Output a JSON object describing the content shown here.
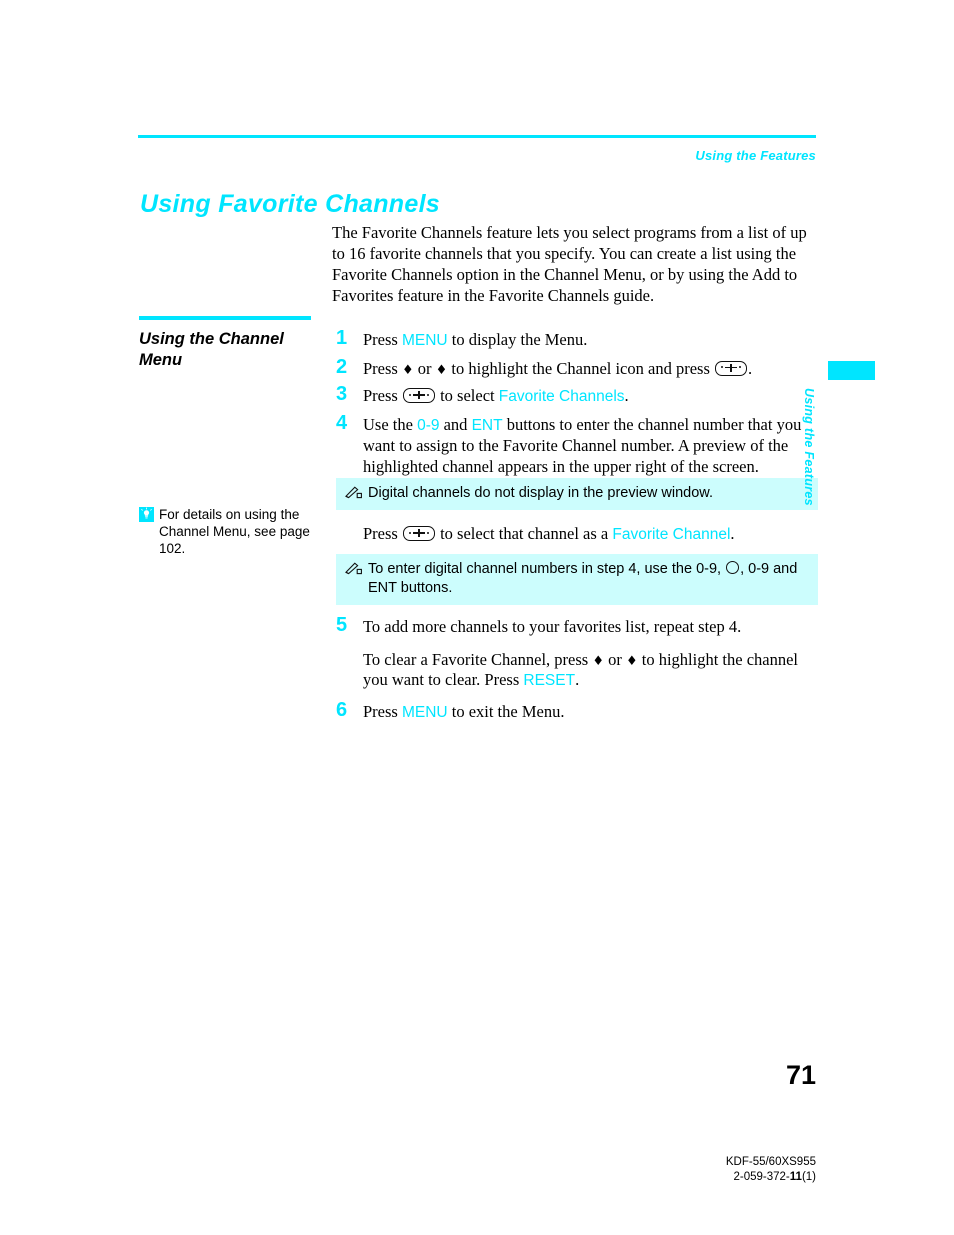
{
  "header": {
    "running_head": "Using the Features",
    "rule_color": "#00e5ff"
  },
  "title": "Using Favorite Channels",
  "intro": "The Favorite Channels feature lets you select programs from a list of up to 16 favorite channels that you specify. You can create a list using the Favorite Channels option in the Channel Menu, or by using the Add to Favorites feature in the Favorite Channels guide.",
  "section": {
    "heading": "Using the Channel Menu"
  },
  "tip": {
    "icon": "lightbulb-icon",
    "text": "For details on using the Channel Menu, see page 102."
  },
  "steps": [
    {
      "num": "1",
      "pre": "Press ",
      "kw1": "MENU",
      "post": " to display the Menu."
    },
    {
      "num": "2",
      "pre": "Press ",
      "up": "♦",
      "mid": " or ",
      "down": "♦",
      "post": " to highlight the Channel icon and press ",
      "end": "."
    },
    {
      "num": "3",
      "pre": "Press ",
      "mid": " to select ",
      "kw1": "Favorite Channels",
      "post": "."
    },
    {
      "num": "4",
      "pre": "Use the ",
      "kw1": "0-9",
      "mid": " and ",
      "kw2": "ENT",
      "post": " buttons to enter the channel number that you want to assign to the Favorite Channel number. A preview of the highlighted channel appears in the upper right of the screen."
    },
    {
      "num": "5",
      "line1": "To add more channels to your favorites list, repeat step 4.",
      "line2_a": "To clear a Favorite Channel, press ",
      "line2_b": " or ",
      "line2_c": " to highlight the channel you want to clear. Press ",
      "kw1": "RESET",
      "line2_d": "."
    },
    {
      "num": "6",
      "pre": "Press ",
      "kw1": "MENU",
      "post": " to exit the Menu."
    }
  ],
  "notes": [
    {
      "icon": "pencil-note-icon",
      "text": "Digital channels do not display in the preview window."
    },
    {
      "icon": "pencil-note-icon",
      "text_a": "To enter digital channel numbers in step 4, use the 0-9, ",
      "text_b": ", 0-9 and ENT buttons."
    }
  ],
  "mid_line": {
    "pre": "Press ",
    "mid": " to select that channel as a ",
    "kw1": "Favorite Channel",
    "post": "."
  },
  "side_tab": {
    "label": "Using the Features",
    "marker_color": "#00e5ff"
  },
  "footer": {
    "page_number": "71",
    "model": "KDF-55/60XS955",
    "doc_code_prefix": "2-059-372-",
    "doc_code_bold": "11",
    "doc_code_suffix": "(1)"
  },
  "colors": {
    "accent": "#00e5ff",
    "note_bg": "#ccfdfd",
    "text": "#000000"
  }
}
